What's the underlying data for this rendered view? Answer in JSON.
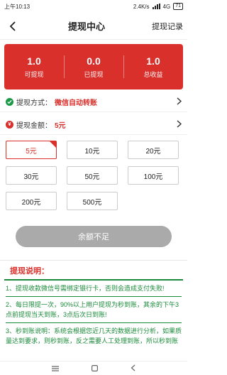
{
  "status_bar": {
    "time": "上午10:13",
    "speed": "2.4K/s",
    "network": "4G",
    "battery": "71"
  },
  "header": {
    "title": "提现中心",
    "record_label": "提现记录"
  },
  "stats": [
    {
      "value": "1.0",
      "label": "可提现"
    },
    {
      "value": "0.0",
      "label": "已提现"
    },
    {
      "value": "1.0",
      "label": "总收益"
    }
  ],
  "method": {
    "label": "提现方式：",
    "value": "微信自动转账"
  },
  "amount": {
    "label": "提现金额：",
    "value": "5元"
  },
  "amount_options": [
    "5元",
    "10元",
    "20元",
    "30元",
    "50元",
    "100元",
    "200元",
    "500元"
  ],
  "selected_amount_index": 0,
  "submit_label": "余额不足",
  "notes": {
    "title": "提现说明：",
    "items": [
      "1、提现收款微信号需绑定银行卡，否则会造成支付失败!",
      "2、每日限提一次，90%以上用户提现为秒到账，其余的下午3点前提现当天到账，3点后次日到账!",
      "3、秒到账说明：系统会根据您近几天的数据进行分析，如果质量达到要求，则秒到账，反之需要人工处理到账，所以秒到账"
    ]
  },
  "colors": {
    "accent": "#d9302c",
    "notes": "#1a8a3a",
    "disabled": "#aaaaaa"
  }
}
